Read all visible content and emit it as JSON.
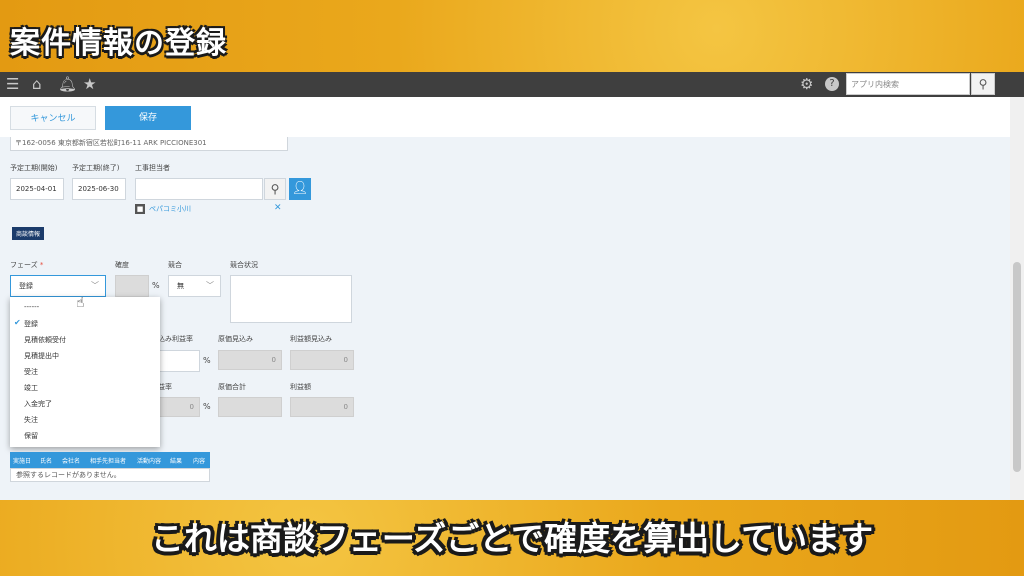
{
  "banner": {
    "title": "案件情報の登録"
  },
  "caption": "これは商談フェーズごとで確度を算出しています",
  "appbar": {
    "icons": [
      "menu-icon",
      "home-icon",
      "bell-icon",
      "star-icon",
      "gear-icon",
      "help-icon",
      "search-icon"
    ],
    "search_placeholder": "アプリ内検索"
  },
  "toolbar": {
    "cancel_label": "キャンセル",
    "save_label": "保存"
  },
  "form": {
    "address_value": "〒162-0056 東京都新宿区若松町16-11 ARK PICCIONE301",
    "start_label": "予定工期(開始)",
    "start_value": "2025-04-01",
    "end_label": "予定工期(終了)",
    "end_value": "2025-06-30",
    "manager_label": "工事担当者",
    "manager_selected": "ペパコミ小川",
    "section_title": "商談情報",
    "phase_label": "フェーズ",
    "phase_required": "*",
    "phase_value": "登録",
    "probability_label": "確度",
    "percent": "%",
    "competition_label": "競合",
    "competition_value": "無",
    "competition_status_label": "競合状況",
    "est_profit_rate_label": "込み利益率",
    "est_cost_label": "原価見込み",
    "est_profit_label": "利益額見込み",
    "zero": "0",
    "profit_rate_label": "益率",
    "cost_total_label": "原価合計",
    "profit_label": "利益額"
  },
  "phase_options": [
    "------",
    "登録",
    "見積依頼受付",
    "見積提出中",
    "受注",
    "竣工",
    "入金完了",
    "失注",
    "保留"
  ],
  "phase_selected_index": 1,
  "table": {
    "headers": [
      "実施日",
      "氏名",
      "会社名",
      "相手先担当者",
      "活動内容",
      "結果",
      "内容"
    ],
    "empty_text": "参照するレコードがありません。"
  }
}
